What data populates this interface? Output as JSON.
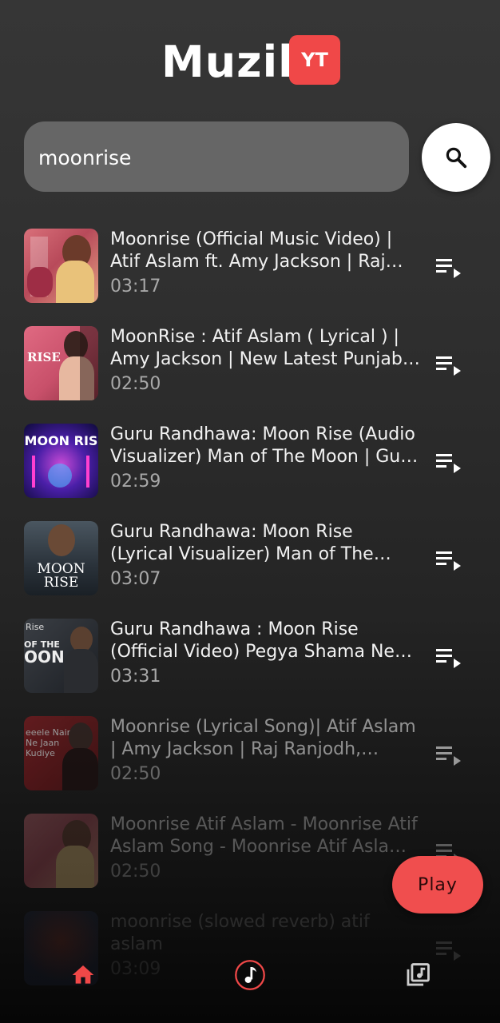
{
  "header": {
    "title": "Muzik",
    "badge": "YT",
    "accent": "#f04848"
  },
  "search": {
    "value": "moonrise",
    "placeholder": ""
  },
  "results": [
    {
      "title": "Moonrise (Official Music Video) | Atif Aslam ft. Amy Jackson | Raj Ranjodh, Adnan Ahmad",
      "duration": "03:17"
    },
    {
      "title": "MoonRise : Atif Aslam ( Lyrical ) | Amy Jackson | New Latest Punjabi Song",
      "duration": "02:50"
    },
    {
      "title": "Guru Randhawa: Moon Rise (Audio Visualizer) Man of The Moon | Guru Randhawa",
      "duration": "02:59"
    },
    {
      "title": "Guru Randhawa: Moon Rise (Lyrical Visualizer) Man of The Moon | Guru Randhawa",
      "duration": "03:07"
    },
    {
      "title": "Guru Randhawa : Moon Rise (Official Video) Pegya Shama Ne Hun Yaad Teri Aundi",
      "duration": "03:31"
    },
    {
      "title": "Moonrise (Lyrical Song)| Atif Aslam | Amy Jackson | Raj Ranjodh, Adnan Ahmad",
      "duration": "02:50"
    },
    {
      "title": "Moonrise Atif Aslam - Moonrise Atif Aslam Song - Moonrise Atif Aslam Lyrics",
      "duration": "02:50"
    },
    {
      "title": "moonrise (slowed reverb) atif aslam",
      "duration": "03:09"
    }
  ],
  "fab": {
    "label": "Play"
  },
  "nav": {
    "items": [
      "home-icon",
      "music-note-icon",
      "library-music-icon"
    ],
    "active": "home",
    "accent": "#f04848"
  },
  "thumb_text": {
    "t2": "RISE",
    "t3": "MOON RIS",
    "t4_line1": "MOON",
    "t4_line2": "RISE",
    "t5_line1": "Rise",
    "t5_line2": "OF THE",
    "t5_line3": "OON",
    "t6_line1": "eeele Nain",
    "t6_line2": "Ne Jaan",
    "t6_line3": "Kudiye"
  }
}
